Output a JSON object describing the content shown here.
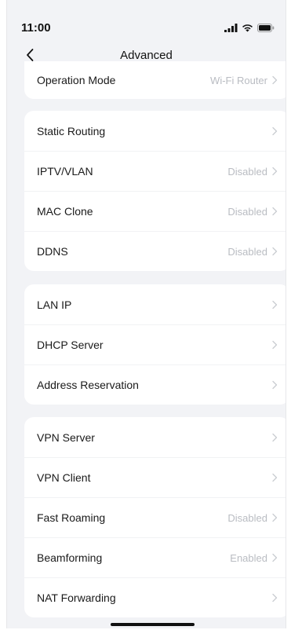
{
  "status_bar": {
    "time": "11:00",
    "icons": [
      "cellular-signal-icon",
      "wifi-icon",
      "battery-icon"
    ]
  },
  "nav": {
    "title": "Advanced",
    "back_icon": "chevron-left-icon"
  },
  "groups": [
    {
      "rows": [
        {
          "label": "Operation Mode",
          "value": "Wi-Fi Router"
        }
      ]
    },
    {
      "rows": [
        {
          "label": "Static Routing",
          "value": ""
        },
        {
          "label": "IPTV/VLAN",
          "value": "Disabled"
        },
        {
          "label": "MAC Clone",
          "value": "Disabled"
        },
        {
          "label": "DDNS",
          "value": "Disabled"
        }
      ]
    },
    {
      "rows": [
        {
          "label": "LAN IP",
          "value": ""
        },
        {
          "label": "DHCP Server",
          "value": ""
        },
        {
          "label": "Address Reservation",
          "value": ""
        }
      ]
    },
    {
      "rows": [
        {
          "label": "VPN Server",
          "value": ""
        },
        {
          "label": "VPN Client",
          "value": ""
        },
        {
          "label": "Fast Roaming",
          "value": "Disabled"
        },
        {
          "label": "Beamforming",
          "value": "Enabled"
        },
        {
          "label": "NAT Forwarding",
          "value": ""
        }
      ]
    }
  ],
  "colors": {
    "background": "#f2f3f6",
    "card": "#ffffff",
    "secondary_text": "#b9bcc2",
    "primary_text": "#1a1a1a"
  }
}
